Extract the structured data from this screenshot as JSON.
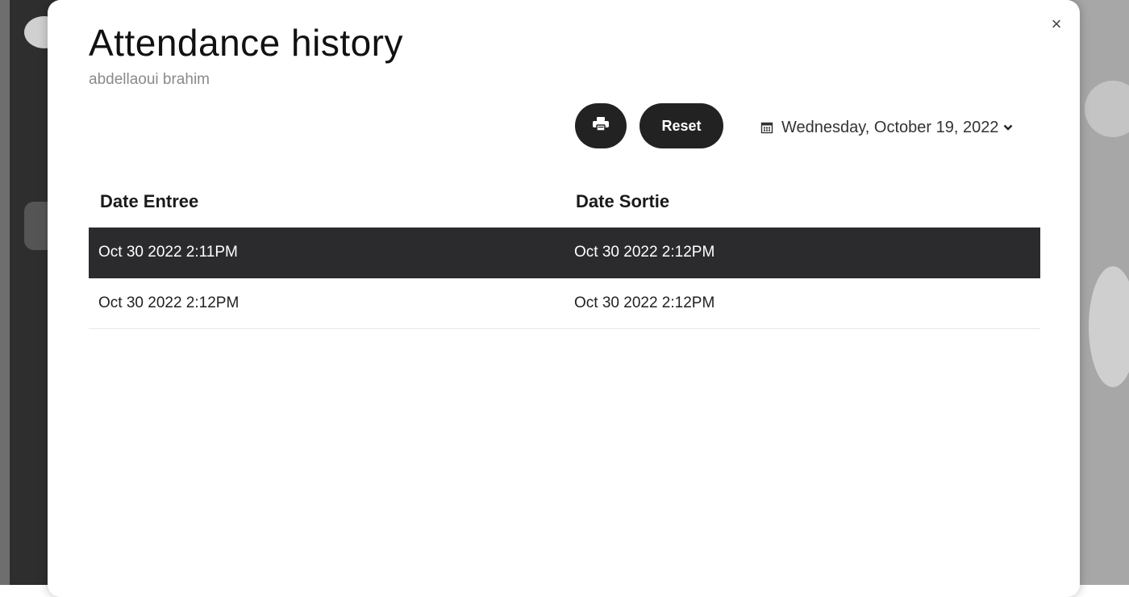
{
  "modal": {
    "title": "Attendance history",
    "subtitle": "abdellaoui brahim",
    "close_label": "×"
  },
  "toolbar": {
    "print_icon": "printer-icon",
    "reset_label": "Reset",
    "date_value": "Wednesday, October 19, 2022",
    "calendar_icon": "calendar-icon",
    "chevron_icon": "chevron-down-icon"
  },
  "table": {
    "headers": [
      "Date Entree",
      "Date Sortie"
    ],
    "rows": [
      {
        "entree": "Oct 30 2022  2:11PM",
        "sortie": "Oct 30 2022  2:12PM",
        "selected": true
      },
      {
        "entree": "Oct 30 2022  2:12PM",
        "sortie": "Oct 30 2022  2:12PM",
        "selected": false
      }
    ]
  },
  "colors": {
    "button_bg": "#222222",
    "selected_row_bg": "#2b2b2e",
    "subtitle": "#8a8a8a"
  }
}
